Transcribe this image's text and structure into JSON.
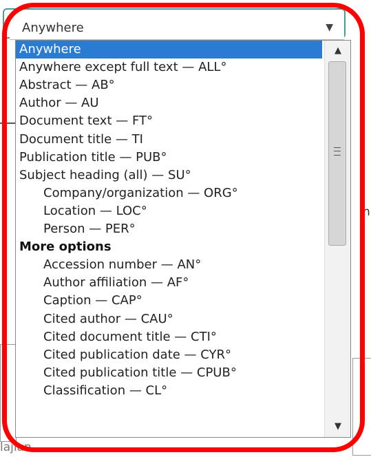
{
  "search_field": {
    "selected_label": "Anywhere",
    "options": [
      {
        "label": "Anywhere",
        "selected": true
      },
      {
        "label": "Anywhere except full text — ALL°"
      },
      {
        "label": "Abstract — AB°"
      },
      {
        "label": "Author — AU"
      },
      {
        "label": "Document text — FT°"
      },
      {
        "label": "Document title — TI"
      },
      {
        "label": "Publication title — PUB°"
      },
      {
        "label": "Subject heading (all) — SU°"
      },
      {
        "label": "Company/organization — ORG°",
        "indent": true
      },
      {
        "label": "Location — LOC°",
        "indent": true
      },
      {
        "label": "Person — PER°",
        "indent": true
      },
      {
        "label": "More options",
        "group": true
      },
      {
        "label": "Accession number — AN°",
        "indent": true
      },
      {
        "label": "Author affiliation — AF°",
        "indent": true
      },
      {
        "label": "Caption — CAP°",
        "indent": true
      },
      {
        "label": "Cited author — CAU°",
        "indent": true
      },
      {
        "label": "Cited document title — CTI°",
        "indent": true
      },
      {
        "label": "Cited publication date — CYR°",
        "indent": true
      },
      {
        "label": "Cited publication title — CPUB°",
        "indent": true
      },
      {
        "label": "Classification — CL°",
        "indent": true
      }
    ]
  },
  "background_fragments": {
    "right_m": "n",
    "bottom_left": "lajian"
  },
  "colors": {
    "selection": "#2a7bd3",
    "highlight_ring": "#ff0000"
  },
  "icons": {
    "dropdown_arrow": "chevron-down-icon",
    "scroll_up": "scroll-up-icon",
    "scroll_down": "scroll-down-icon"
  }
}
